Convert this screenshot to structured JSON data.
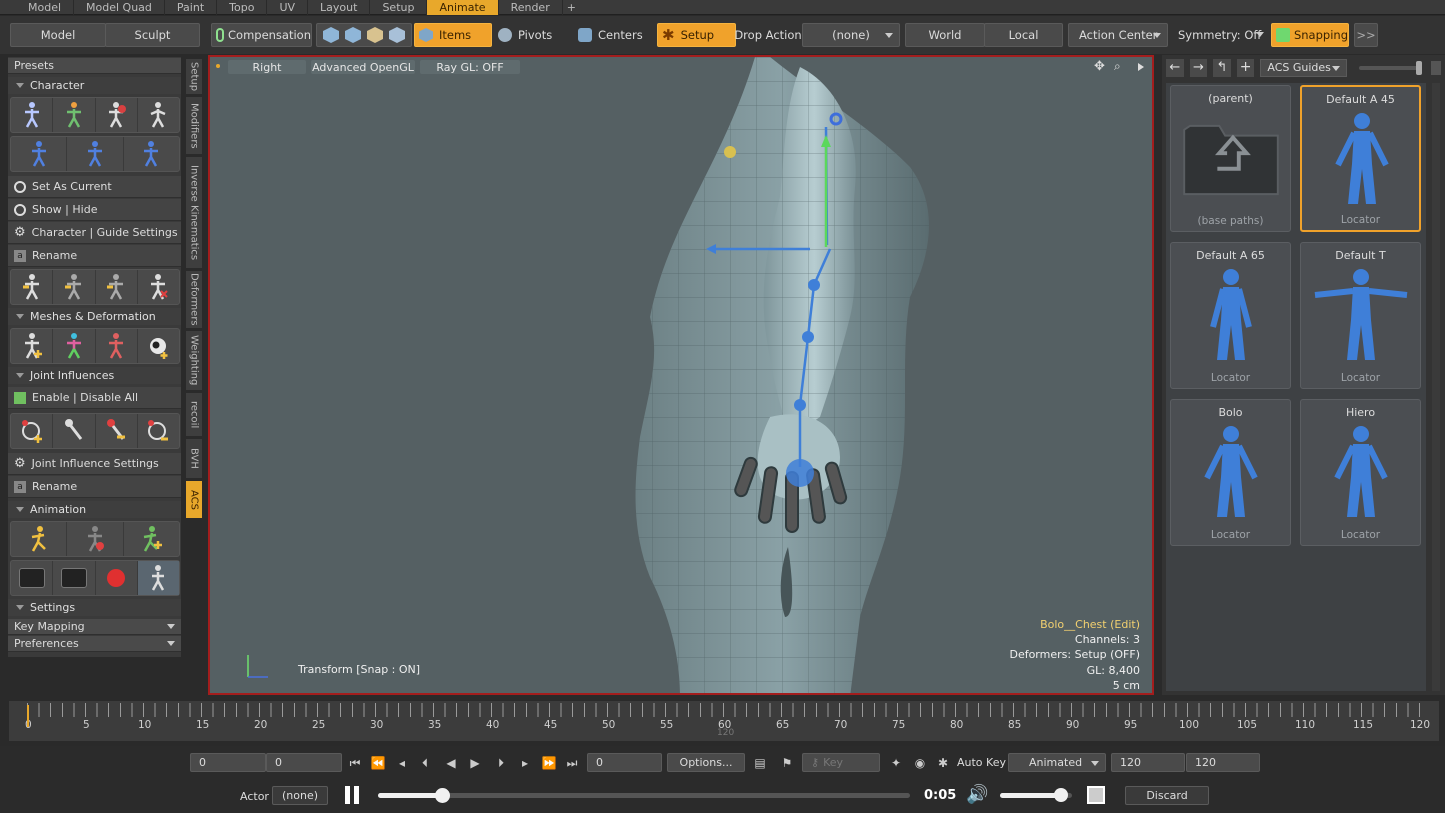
{
  "top_tabs": [
    "Model",
    "Model Quad",
    "Paint",
    "Topo",
    "UV",
    "Layout",
    "Setup",
    "Animate",
    "Render",
    "+"
  ],
  "active_top_tab": "Animate",
  "toolbar": {
    "model": "Model",
    "sculpt": "Sculpt",
    "compensation": "Compensation",
    "items": "Items",
    "pivots": "Pivots",
    "centers": "Centers",
    "setup": "Setup",
    "drop_action_label": "Drop Action",
    "drop_action_value": "(none)",
    "world": "World",
    "local": "Local",
    "action_center": "Action Center",
    "symmetry": "Symmetry: Off",
    "snapping": "Snapping",
    "more": ">>"
  },
  "left_panel": {
    "presets": "Presets",
    "character": "Character",
    "set_as_current": "Set As Current",
    "show_hide": "Show | Hide",
    "char_guide_settings": "Character | Guide Settings",
    "rename1": "Rename",
    "meshes": "Meshes & Deformation",
    "joint_influences": "Joint Influences",
    "enable_disable": "Enable | Disable All",
    "joint_infl_settings": "Joint Influence Settings",
    "rename2": "Rename",
    "animation": "Animation",
    "settings": "Settings",
    "key_mapping": "Key Mapping",
    "preferences": "Preferences"
  },
  "vertical_tabs": [
    "Setup",
    "Modifiers",
    "Inverse Kinematics",
    "Deformers",
    "Weighting",
    "recoil",
    "BVH",
    "ACS"
  ],
  "viewport": {
    "view": "Right",
    "renderer": "Advanced OpenGL",
    "raygl": "Ray GL: OFF",
    "transform": "Transform  [Snap : ON]",
    "info": {
      "item": "Bolo__Chest (Edit)",
      "channels": "Channels: 3",
      "deformers": "Deformers: Setup (OFF)",
      "gl": "GL: 8,400",
      "scale": "5 cm"
    }
  },
  "right_panel": {
    "dropdown": "ACS Guides",
    "cards": [
      {
        "title": "(parent)",
        "foot": "(base paths)"
      },
      {
        "title": "Default A 45",
        "foot": "Locator"
      },
      {
        "title": "Default A 65",
        "foot": "Locator"
      },
      {
        "title": "Default T",
        "foot": "Locator"
      },
      {
        "title": "Bolo",
        "foot": "Locator"
      },
      {
        "title": "Hiero",
        "foot": "Locator"
      }
    ]
  },
  "timeline": {
    "ticks": [
      "0",
      "5",
      "10",
      "15",
      "20",
      "25",
      "30",
      "35",
      "40",
      "45",
      "50",
      "55",
      "60",
      "65",
      "70",
      "75",
      "80",
      "85",
      "90",
      "95",
      "100",
      "105",
      "110",
      "115",
      "120"
    ],
    "end_label": "120"
  },
  "transport": {
    "start": "0",
    "current": "0",
    "frame": "0",
    "options": "Options...",
    "key": "Key",
    "auto_key": "Auto Key",
    "animated": "Animated",
    "end1": "120",
    "end2": "120",
    "actor": "Actor",
    "actor_value": "(none)",
    "time": "0:05",
    "discard": "Discard",
    "progress": 0.12,
    "volume": 0.85
  },
  "colors": {
    "accent": "#f0a22b",
    "viewport_border": "#a31d1d",
    "locator_blue": "#3f7fd8"
  }
}
